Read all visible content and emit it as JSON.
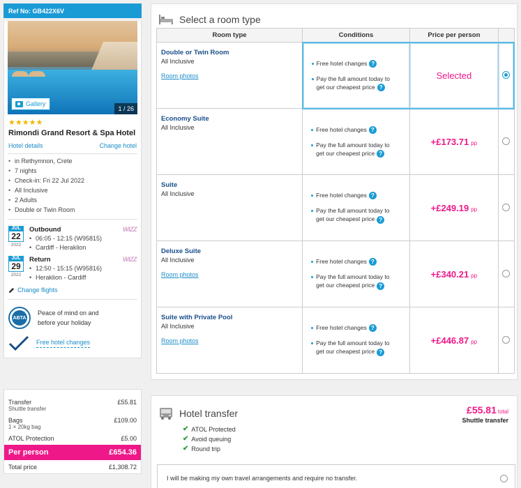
{
  "left": {
    "ref_label": "Ref No: GB422X6V",
    "gallery_label": "Gallery",
    "photo_counter": "1 / 26",
    "stars": "★★★★★",
    "hotel_name": "Rimondi Grand Resort & Spa Hotel",
    "hotel_details_link": "Hotel details",
    "change_hotel_link": "Change hotel",
    "facts": [
      "in Rethymnon, Crete",
      "7 nights",
      "Check-in: Fri 22 Jul 2022",
      "All Inclusive",
      "2 Adults",
      "Double or Twin Room"
    ],
    "outbound": {
      "mon": "JUL",
      "day": "22",
      "yr": "2022",
      "title": "Outbound",
      "time": "06:05 - 12:15 (W95815)",
      "route": "Cardiff - Heraklion",
      "airline": "WIZZ"
    },
    "return": {
      "mon": "JUL",
      "day": "29",
      "yr": "2022",
      "title": "Return",
      "time": "12:50 - 15:15 (W95816)",
      "route": "Heraklion - Cardiff",
      "airline": "WIZZ"
    },
    "change_flights": "Change flights",
    "peace_line1": "Peace of mind on and",
    "peace_line2": "before your holiday",
    "abta": "ABTA",
    "free_changes": "Free hotel changes"
  },
  "price_summary": {
    "transfer_label": "Transfer",
    "transfer_value": "£55.81",
    "transfer_sub": "Shuttle transfer",
    "bags_label": "Bags",
    "bags_value": "£109.00",
    "bags_sub": "1 × 20kg bag",
    "atol_label": "ATOL Protection",
    "atol_value": "£5.00",
    "per_person_label": "Per person",
    "per_person_value": "£654.36",
    "total_label": "Total price",
    "total_value": "£1,308.72"
  },
  "room_section": {
    "title": "Select a room type",
    "headers": [
      "Room type",
      "Conditions",
      "Price per person"
    ],
    "cond1": "Free hotel changes",
    "cond2a": "Pay the full amount today to",
    "cond2b": "get our cheapest price",
    "pp": "pp",
    "rooms": [
      {
        "name": "Double or Twin Room",
        "board": "All Inclusive",
        "photos": "Room photos",
        "price": "Selected"
      },
      {
        "name": "Economy Suite",
        "board": "All Inclusive",
        "photos": "",
        "price": "+£173.71"
      },
      {
        "name": "Suite",
        "board": "All Inclusive",
        "photos": "",
        "price": "+£249.19"
      },
      {
        "name": "Deluxe Suite",
        "board": "All Inclusive",
        "photos": "Room photos",
        "price": "+£340.21"
      },
      {
        "name": "Suite with Private Pool",
        "board": "All Inclusive",
        "photos": "Room photos",
        "price": "+£446.87"
      }
    ]
  },
  "transfer": {
    "title": "Hotel transfer",
    "price": "£55.81",
    "total_label": "total",
    "name": "Shuttle transfer",
    "features": [
      "ATOL Protected",
      "Avoid queuing",
      "Round trip"
    ],
    "own_option": "I will be making my own travel arrangements and require no transfer."
  },
  "colors": {
    "accent": "#1a9bd5",
    "pink": "#ee1889",
    "green": "#2a9a3a"
  }
}
